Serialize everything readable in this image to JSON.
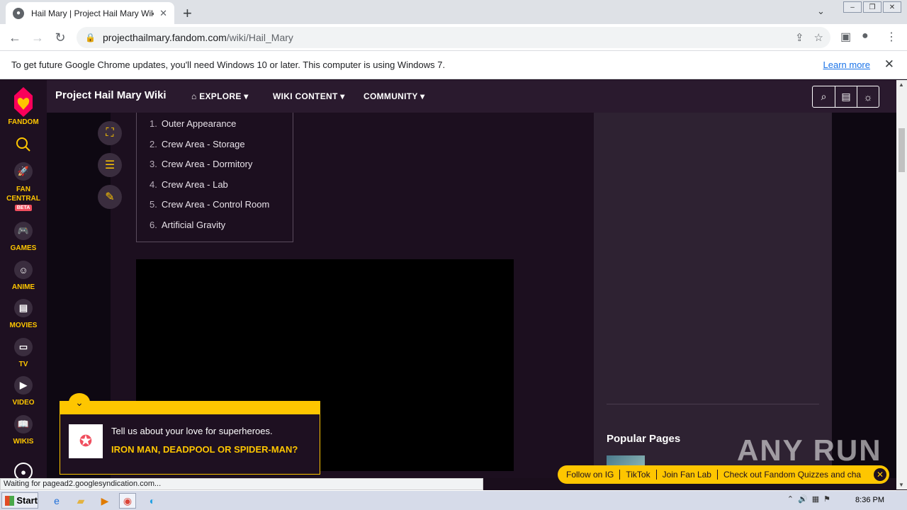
{
  "browser": {
    "tab_title": "Hail Mary | Project Hail Mary Wiki | F",
    "url_host": "projecthailmary.fandom.com",
    "url_path": "/wiki/Hail_Mary",
    "infobar_text": "To get future Google Chrome updates, you'll need Windows 10 or later. This computer is using Windows 7.",
    "infobar_link": "Learn more",
    "status_text": "Waiting for pagead2.googlesyndication.com..."
  },
  "rail": {
    "brand": "FANDOM",
    "items": [
      {
        "label": "FAN\nCENTRAL",
        "icon": "rocket-icon"
      },
      {
        "label": "GAMES",
        "icon": "gamepad-icon"
      },
      {
        "label": "ANIME",
        "icon": "anime-icon"
      },
      {
        "label": "MOVIES",
        "icon": "clapper-icon"
      },
      {
        "label": "TV",
        "icon": "tv-icon"
      },
      {
        "label": "VIDEO",
        "icon": "play-icon"
      },
      {
        "label": "WIKIS",
        "icon": "book-icon"
      }
    ],
    "beta": "BETA"
  },
  "wiki": {
    "title": "Project Hail Mary Wiki",
    "nav": [
      "EXPLORE",
      "WIKI CONTENT",
      "COMMUNITY"
    ]
  },
  "toc": [
    {
      "n": "1.",
      "label": "Outer Appearance"
    },
    {
      "n": "2.",
      "label": "Crew Area - Storage"
    },
    {
      "n": "3.",
      "label": "Crew Area - Dormitory"
    },
    {
      "n": "4.",
      "label": "Crew Area - Lab"
    },
    {
      "n": "5.",
      "label": "Crew Area - Control Room"
    },
    {
      "n": "6.",
      "label": "Artificial Gravity"
    }
  ],
  "sidebar": {
    "popular_pages": "Popular Pages"
  },
  "popup": {
    "question": "Tell us about your love for superheroes.",
    "answer": "IRON MAN, DEADPOOL OR SPIDER-MAN?"
  },
  "promo": [
    "Follow on IG",
    "TikTok",
    "Join Fan Lab",
    "Check out Fandom Quizzes and cha"
  ],
  "watermark": "ANY RUN",
  "taskbar": {
    "start": "Start",
    "clock": "8:36 PM"
  },
  "colors": {
    "accent": "#fec600",
    "rail_bg": "#1e1021",
    "page_bg": "#0e0812"
  }
}
